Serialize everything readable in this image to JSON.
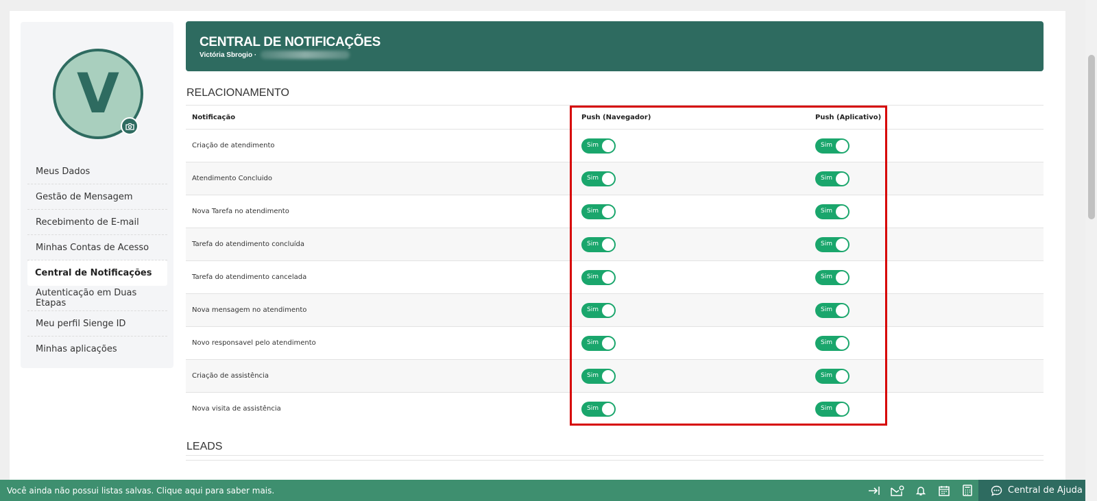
{
  "sidebar": {
    "avatar_letter": "V",
    "items": [
      {
        "label": "Meus Dados"
      },
      {
        "label": "Gestão de Mensagem"
      },
      {
        "label": "Recebimento de E-mail"
      },
      {
        "label": "Minhas Contas de Acesso"
      },
      {
        "label": "Central de Notificações"
      },
      {
        "label": "Autenticação em Duas Etapas"
      },
      {
        "label": "Meu perfil Sienge ID"
      },
      {
        "label": "Minhas aplicações"
      }
    ],
    "active_index": 4
  },
  "header": {
    "title": "CENTRAL DE NOTIFICAÇÕES",
    "user": "Victória Sbrogio ·"
  },
  "sections": {
    "relacionamento": "RELACIONAMENTO",
    "leads": "LEADS"
  },
  "table": {
    "columns": [
      "Notificação",
      "Push (Navegador)",
      "Push (Aplicativo)"
    ],
    "toggle_label": "Sim",
    "rows": [
      {
        "name": "Criação de atendimento"
      },
      {
        "name": "Atendimento Concluido"
      },
      {
        "name": "Nova Tarefa no atendimento"
      },
      {
        "name": "Tarefa do atendimento concluída"
      },
      {
        "name": "Tarefa do atendimento cancelada"
      },
      {
        "name": "Nova mensagem no atendimento"
      },
      {
        "name": "Novo responsavel pelo atendimento"
      },
      {
        "name": "Criação de assistência"
      },
      {
        "name": "Nova visita de assistência"
      }
    ]
  },
  "bottom_bar": {
    "message": "Você ainda não possui listas salvas. Clique aqui para saber mais.",
    "icons": [
      "collapse-icon",
      "mail-settings-icon",
      "bell-icon",
      "calendar-icon",
      "calculator-icon"
    ],
    "help_label": "Central de Ajuda"
  },
  "colors": {
    "primary": "#2e6b60",
    "toggle_on": "#1aa66c",
    "bottom_bar": "#3e8f6f",
    "highlight": "#d60000"
  }
}
